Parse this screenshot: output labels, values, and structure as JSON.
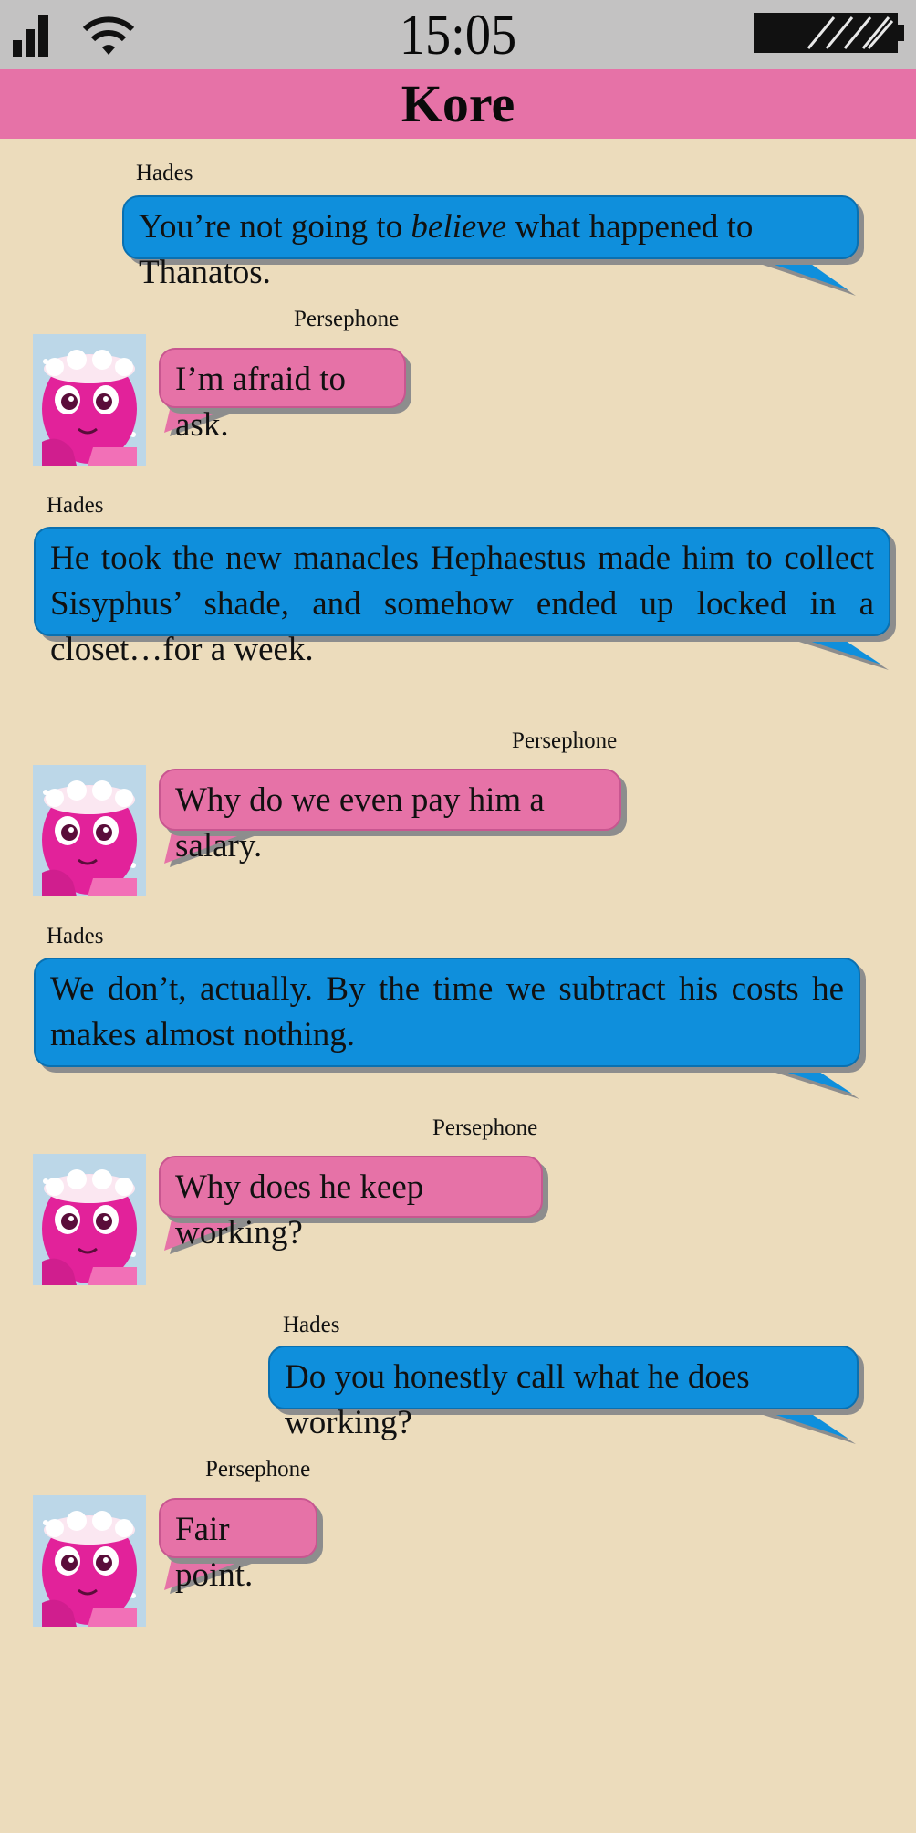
{
  "status_bar": {
    "time": "15:05",
    "signal_icon": "cellular-signal-icon",
    "wifi_icon": "wifi-icon",
    "battery_icon": "battery-icon"
  },
  "header": {
    "title": "Kore"
  },
  "colors": {
    "hades_bubble": "#0f8fdc",
    "persephone_bubble": "#e672a7",
    "header_bar": "#e672a7",
    "status_bar": "#c3c2c2",
    "background": "#ecdcbc"
  },
  "messages": [
    {
      "sender": "Hades",
      "text_before": "You’re not going to ",
      "text_emphasis": "believe",
      "text_after": " what happened to Thanatos."
    },
    {
      "sender": "Persephone",
      "text": "I’m afraid to ask."
    },
    {
      "sender": "Hades",
      "text": "He took the new manacles Hephaestus made him to collect Sisyphus’ shade, and somehow ended up locked in a closet…for a week."
    },
    {
      "sender": "Persephone",
      "text": "Why do we even pay him a salary."
    },
    {
      "sender": "Hades",
      "text": "We don’t, actually. By the time we subtract his costs he makes almost nothing."
    },
    {
      "sender": "Persephone",
      "text": "Why does he keep working?"
    },
    {
      "sender": "Hades",
      "text": "Do you honestly call what he does working?"
    },
    {
      "sender": "Persephone",
      "text": "Fair point."
    }
  ]
}
